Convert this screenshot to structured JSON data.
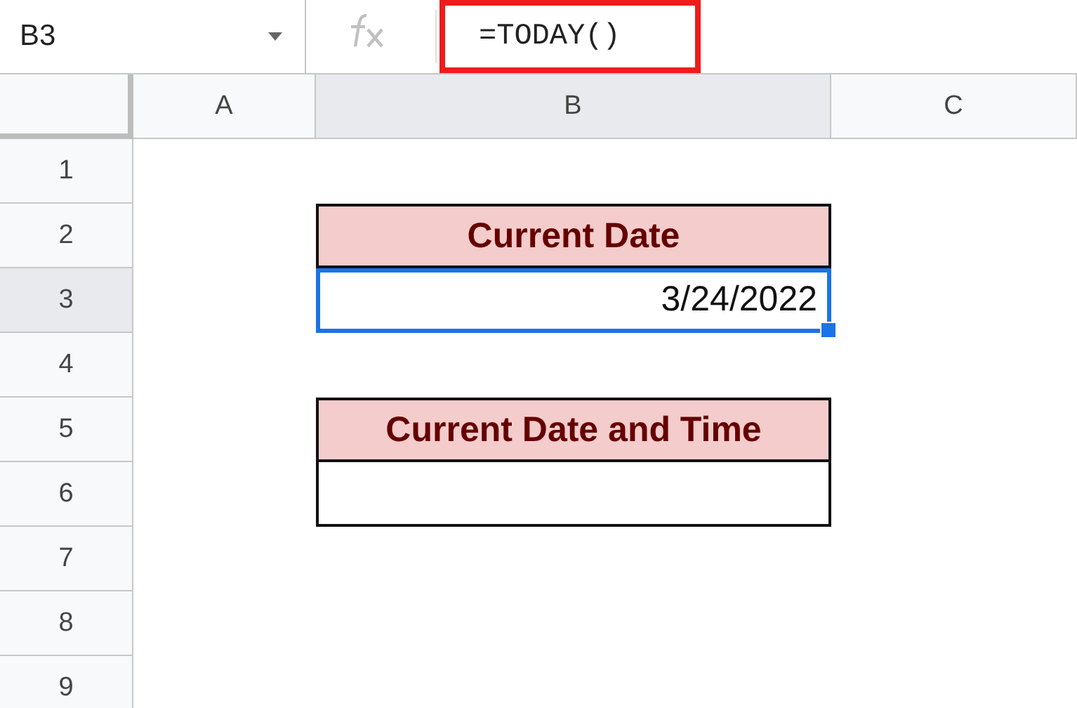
{
  "formula_bar": {
    "name_box": "B3",
    "formula": "=TODAY()",
    "highlighted": true
  },
  "columns": [
    {
      "label": "A",
      "selected": false
    },
    {
      "label": "B",
      "selected": true
    },
    {
      "label": "C",
      "selected": false
    }
  ],
  "rows": [
    {
      "label": "1",
      "selected": false
    },
    {
      "label": "2",
      "selected": false,
      "cell_b": {
        "kind": "header",
        "text": "Current Date",
        "selected": false
      }
    },
    {
      "label": "3",
      "selected": true,
      "cell_b": {
        "kind": "value",
        "text": "3/24/2022",
        "selected": true
      }
    },
    {
      "label": "4",
      "selected": false
    },
    {
      "label": "5",
      "selected": false,
      "cell_b": {
        "kind": "header",
        "text": "Current Date and Time",
        "selected": false
      }
    },
    {
      "label": "6",
      "selected": false,
      "cell_b": {
        "kind": "value",
        "selected": false
      }
    },
    {
      "label": "7",
      "selected": false
    },
    {
      "label": "8",
      "selected": false
    },
    {
      "label": "9",
      "selected": false
    }
  ]
}
